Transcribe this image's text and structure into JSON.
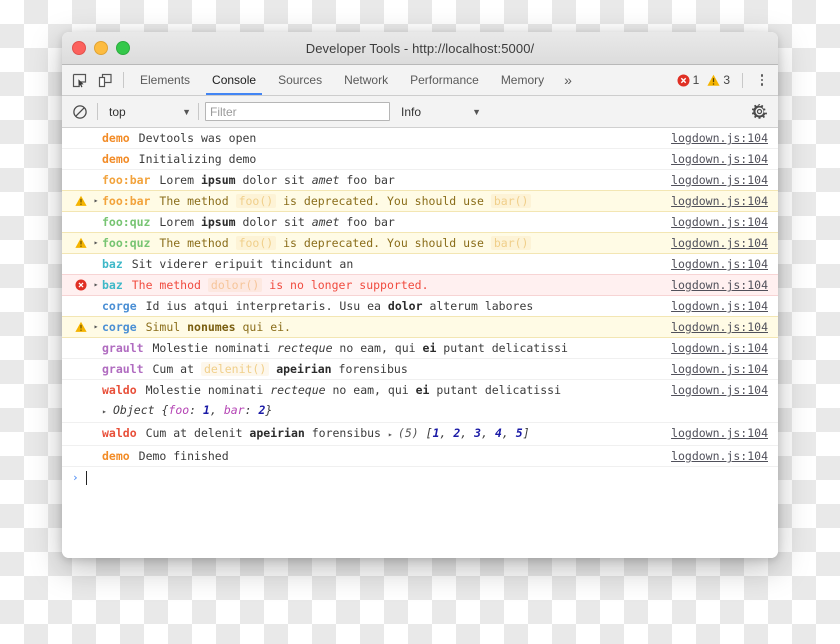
{
  "window": {
    "title": "Developer Tools - http://localhost:5000/",
    "traffic_lights": [
      "close-button",
      "minimize-button",
      "maximize-button"
    ]
  },
  "tabbar": {
    "inspect_icon": "inspect-element-icon",
    "device_icon": "device-toolbar-icon",
    "tabs": [
      {
        "label": "Elements",
        "selected": false
      },
      {
        "label": "Console",
        "selected": true
      },
      {
        "label": "Sources",
        "selected": false
      },
      {
        "label": "Network",
        "selected": false
      },
      {
        "label": "Performance",
        "selected": false
      },
      {
        "label": "Memory",
        "selected": false
      }
    ],
    "more_tabs_label": "»",
    "error_icon": "error-circle-icon",
    "error_count": "1",
    "warning_icon": "warning-triangle-icon",
    "warning_count": "3",
    "menu_icon": "kebab-menu-icon",
    "error_color": "#e03024",
    "warning_color": "#f5b400",
    "accent_color": "#4285f4"
  },
  "filterbar": {
    "clear_icon": "clear-console-icon",
    "context_value": "top",
    "context_caret": "▼",
    "filter_placeholder": "Filter",
    "filter_value": "",
    "level_value": "Info",
    "level_caret": "▼",
    "settings_icon": "gear-icon"
  },
  "console": {
    "source_link": "logdown.js:104",
    "prompt_chevron": "›",
    "rows": [
      {
        "level": "log",
        "icon": null,
        "expandable": false,
        "namespace": "demo",
        "ns_color": "#f28c28",
        "parts": [
          {
            "t": "Devtools was open",
            "s": "plain"
          }
        ]
      },
      {
        "level": "log",
        "icon": null,
        "expandable": false,
        "namespace": "demo",
        "ns_color": "#f28c28",
        "parts": [
          {
            "t": "Initializing demo",
            "s": "plain"
          }
        ]
      },
      {
        "level": "log",
        "icon": null,
        "expandable": false,
        "namespace": "foo:bar",
        "ns_color": "#f2a33c",
        "parts": [
          {
            "t": "Lorem ",
            "s": "plain"
          },
          {
            "t": "ipsum",
            "s": "bold"
          },
          {
            "t": " dolor sit ",
            "s": "plain"
          },
          {
            "t": "amet",
            "s": "italic"
          },
          {
            "t": " foo bar",
            "s": "plain"
          }
        ]
      },
      {
        "level": "warning",
        "icon": "warning-triangle-icon",
        "expandable": true,
        "namespace": "foo:bar",
        "ns_color": "#f2a33c",
        "parts": [
          {
            "t": "The method ",
            "s": "plain"
          },
          {
            "t": "foo()",
            "s": "code"
          },
          {
            "t": " is deprecated. You should use ",
            "s": "plain"
          },
          {
            "t": "bar()",
            "s": "code"
          }
        ]
      },
      {
        "level": "log",
        "icon": null,
        "expandable": false,
        "namespace": "foo:quz",
        "ns_color": "#77c472",
        "parts": [
          {
            "t": "Lorem ",
            "s": "plain"
          },
          {
            "t": "ipsum",
            "s": "bold"
          },
          {
            "t": " dolor sit ",
            "s": "plain"
          },
          {
            "t": "amet",
            "s": "italic"
          },
          {
            "t": " foo bar",
            "s": "plain"
          }
        ]
      },
      {
        "level": "warning",
        "icon": "warning-triangle-icon",
        "expandable": true,
        "namespace": "foo:quz",
        "ns_color": "#77c472",
        "parts": [
          {
            "t": "The method ",
            "s": "plain"
          },
          {
            "t": "foo()",
            "s": "code"
          },
          {
            "t": " is deprecated. You should use ",
            "s": "plain"
          },
          {
            "t": "bar()",
            "s": "code"
          }
        ]
      },
      {
        "level": "log",
        "icon": null,
        "expandable": false,
        "namespace": "baz",
        "ns_color": "#3fb8c8",
        "parts": [
          {
            "t": "Sit viderer eripuit tincidunt an",
            "s": "plain"
          }
        ]
      },
      {
        "level": "error",
        "icon": "error-circle-icon",
        "expandable": true,
        "namespace": "baz",
        "ns_color": "#3fb8c8",
        "parts": [
          {
            "t": "The method ",
            "s": "plain"
          },
          {
            "t": "dolor()",
            "s": "code"
          },
          {
            "t": " is no longer supported.",
            "s": "plain"
          }
        ]
      },
      {
        "level": "log",
        "icon": null,
        "expandable": false,
        "namespace": "corge",
        "ns_color": "#4b8fd4",
        "parts": [
          {
            "t": "Id ius atqui interpretaris. Usu ea ",
            "s": "plain"
          },
          {
            "t": "dolor",
            "s": "bold"
          },
          {
            "t": " alterum labores",
            "s": "plain"
          }
        ]
      },
      {
        "level": "warning",
        "icon": "warning-triangle-icon",
        "expandable": true,
        "namespace": "corge",
        "ns_color": "#4b8fd4",
        "parts": [
          {
            "t": "Simul ",
            "s": "plain"
          },
          {
            "t": "nonumes",
            "s": "bold"
          },
          {
            "t": " qui ei.",
            "s": "plain"
          }
        ]
      },
      {
        "level": "log",
        "icon": null,
        "expandable": false,
        "namespace": "grault",
        "ns_color": "#b06cc0",
        "parts": [
          {
            "t": "Molestie nominati ",
            "s": "plain"
          },
          {
            "t": "recteque",
            "s": "italic"
          },
          {
            "t": " no eam, qui ",
            "s": "plain"
          },
          {
            "t": "ei",
            "s": "bold"
          },
          {
            "t": " putant delicatissi",
            "s": "plain"
          }
        ]
      },
      {
        "level": "log",
        "icon": null,
        "expandable": false,
        "namespace": "grault",
        "ns_color": "#b06cc0",
        "parts": [
          {
            "t": "Cum at ",
            "s": "plain"
          },
          {
            "t": "delenit()",
            "s": "code-dim"
          },
          {
            "t": " ",
            "s": "plain"
          },
          {
            "t": "apeirian",
            "s": "bold"
          },
          {
            "t": " forensibus",
            "s": "plain"
          }
        ]
      },
      {
        "level": "log",
        "icon": null,
        "expandable": false,
        "namespace": "waldo",
        "ns_color": "#e8503a",
        "parts": [
          {
            "t": "Molestie nominati ",
            "s": "plain"
          },
          {
            "t": "recteque",
            "s": "italic"
          },
          {
            "t": " no eam, qui ",
            "s": "plain"
          },
          {
            "t": "ei",
            "s": "bold"
          },
          {
            "t": " putant delicatissi",
            "s": "plain"
          }
        ],
        "object_preview": {
          "arrow": "▸",
          "ctor": "Object",
          "open": "{",
          "entries": [
            {
              "key": "foo",
              "sep": ": ",
              "value": "1"
            },
            {
              "key": "bar",
              "sep": ": ",
              "value": "2"
            }
          ],
          "comma": ", ",
          "close": "}"
        }
      },
      {
        "level": "log",
        "icon": null,
        "expandable": false,
        "namespace": "waldo",
        "ns_color": "#e8503a",
        "parts": [
          {
            "t": "Cum at delenit ",
            "s": "plain"
          },
          {
            "t": "apeirian",
            "s": "bold"
          },
          {
            "t": " forensibus ",
            "s": "plain"
          }
        ],
        "array_preview": {
          "arrow": "▸",
          "length": "(5)",
          "open": "[",
          "values": [
            "1",
            "2",
            "3",
            "4",
            "5"
          ],
          "comma": ", ",
          "close": "]"
        }
      },
      {
        "level": "log",
        "icon": null,
        "expandable": false,
        "namespace": "demo",
        "ns_color": "#f28c28",
        "parts": [
          {
            "t": "Demo finished",
            "s": "plain"
          }
        ]
      }
    ]
  }
}
